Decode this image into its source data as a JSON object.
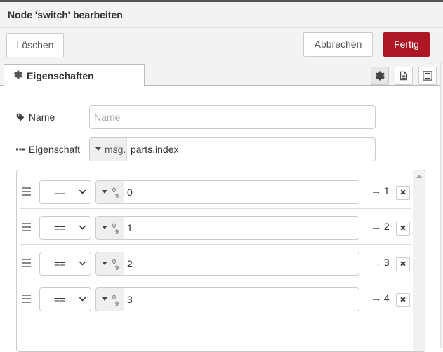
{
  "dialog": {
    "title": "Node 'switch' bearbeiten",
    "buttons": {
      "delete": "Löschen",
      "cancel": "Abbrechen",
      "done": "Fertig"
    },
    "tab": {
      "label": "Eigenschaften"
    },
    "colors": {
      "primary": "#ad1625",
      "header_bg": "#f3f3f3",
      "border": "#cccccc"
    }
  },
  "form": {
    "name": {
      "label": "Name",
      "placeholder": "Name",
      "value": ""
    },
    "property": {
      "label": "Eigenschaft",
      "type": "msg.",
      "value": "parts.index"
    }
  },
  "rules": [
    {
      "operator": "==",
      "type_icon": "number",
      "value": "0",
      "output": "→ 1"
    },
    {
      "operator": "==",
      "type_icon": "number",
      "value": "1",
      "output": "→ 2"
    },
    {
      "operator": "==",
      "type_icon": "number",
      "value": "2",
      "output": "→ 3"
    },
    {
      "operator": "==",
      "type_icon": "number",
      "value": "3",
      "output": "→ 4"
    }
  ]
}
